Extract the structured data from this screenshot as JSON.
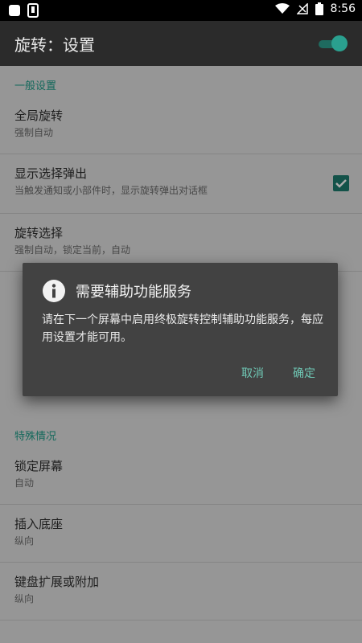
{
  "status_bar": {
    "time": "8:56",
    "left_icons": [
      "notification-square-icon",
      "phone-notification-icon"
    ],
    "right_icons": [
      "wifi-icon",
      "signal-off-icon",
      "battery-icon"
    ]
  },
  "app_bar": {
    "title": "旋转：设置",
    "master_toggle_on": true
  },
  "list": {
    "general_header": "一般设置",
    "global_rotation": {
      "title": "全局旋转",
      "summary": "强制自动"
    },
    "show_popup": {
      "title": "显示选择弹出",
      "summary": "当触发通知或小部件时，显示旋转弹出对话框",
      "checked": true
    },
    "rotation_select": {
      "title": "旋转选择",
      "summary": "强制自动，锁定当前，自动"
    },
    "special_header": "特殊情况",
    "lock_screen": {
      "title": "锁定屏幕",
      "summary": "自动"
    },
    "insert_dock": {
      "title": "插入底座",
      "summary": "纵向"
    },
    "keyboard_ext": {
      "title": "键盘扩展或附加",
      "summary": "纵向"
    }
  },
  "dialog": {
    "icon": "info-icon",
    "title": "需要辅助功能服务",
    "message": "请在下一个屏幕中启用终极旋转控制辅助功能服务，每应用设置才能可用。",
    "cancel_label": "取消",
    "ok_label": "确定"
  },
  "colors": {
    "accent": "#1d9a87",
    "dialog_button": "#6fc7b4",
    "app_bar": "#2b2b2b",
    "dialog_bg": "#424242"
  }
}
